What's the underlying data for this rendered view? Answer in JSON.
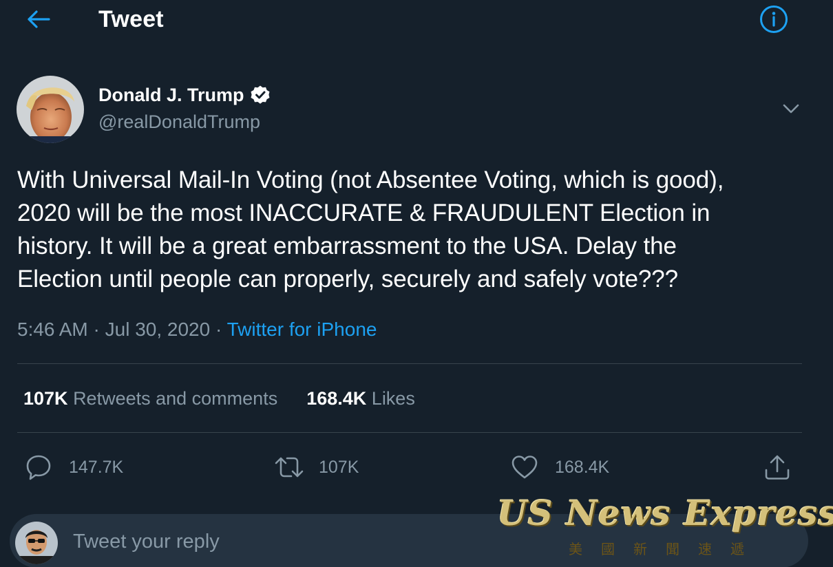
{
  "header": {
    "title": "Tweet",
    "back_icon": "arrow-left-icon",
    "info_icon": "info-icon"
  },
  "author": {
    "name": "Donald J. Trump",
    "handle": "@realDonaldTrump",
    "verified": true
  },
  "tweet": {
    "text": "With Universal Mail-In Voting (not Absentee Voting, which is good),\n2020 will be the most INACCURATE & FRAUDULENT Election in\nhistory. It will be a great embarrassment to the USA. Delay the\nElection until people can properly, securely and safely vote???",
    "time": "5:46 AM",
    "date": "Jul 30, 2020",
    "separator": "·",
    "source": "Twitter for iPhone"
  },
  "stats": {
    "retweets_count": "107K",
    "retweets_label": "Retweets and comments",
    "likes_count": "168.4K",
    "likes_label": "Likes"
  },
  "actions": {
    "reply_count": "147.7K",
    "retweet_count": "107K",
    "like_count": "168.4K"
  },
  "reply": {
    "placeholder": "Tweet your reply"
  },
  "watermark": {
    "title": "US News Express",
    "subtitle": "美國新聞速遞"
  },
  "colors": {
    "background": "#15202b",
    "accent": "#1da1f2",
    "secondary_text": "#8899a6",
    "divider": "#38444d",
    "reply_bar": "#253341",
    "watermark_gold": "#d4c07a"
  }
}
